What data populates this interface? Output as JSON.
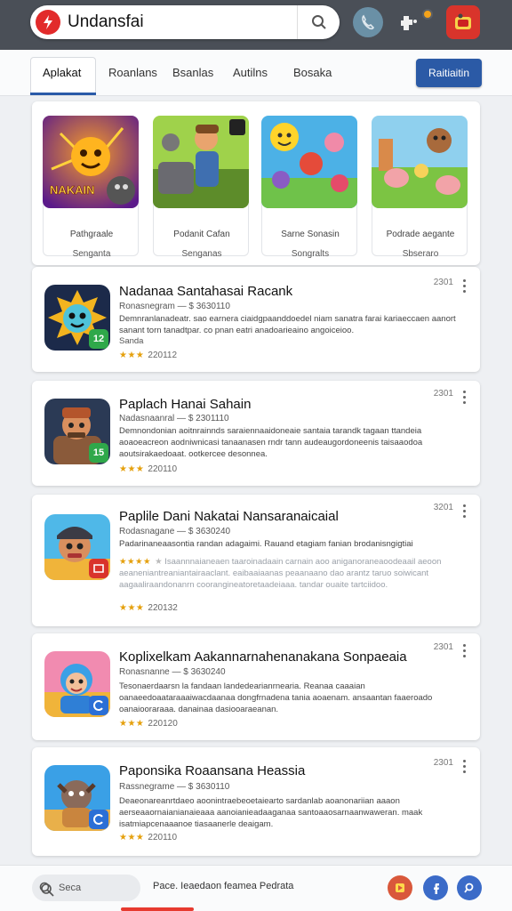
{
  "header": {
    "search_value": "Undansfai",
    "icons": [
      "app-logo-icon",
      "search-icon",
      "phone-icon",
      "extension-icon",
      "notification-dot-icon",
      "app-tile-icon"
    ]
  },
  "tabs": [
    {
      "label": "Aplakat"
    },
    {
      "label": "Roanlans"
    },
    {
      "label": "Bsanlas"
    },
    {
      "label": "Autilns"
    },
    {
      "label": "Bosaka"
    }
  ],
  "action_button": "Raitiaitin",
  "featured": [
    {
      "name": "Pathgraale",
      "sub": "Senganta",
      "art_text": "NAKAIN"
    },
    {
      "name": "Podanit Cafan",
      "sub": "Senganas"
    },
    {
      "name": "Sarne Sonasin",
      "sub": "Songralts"
    },
    {
      "name": "Podrade aegante",
      "sub": "Sbseraro"
    }
  ],
  "apps": [
    {
      "title": "Nadanaa Santahasai Racank",
      "meta": "Ronasnegram — $ 3630110",
      "desc": "Demnranlanadeatr. sao earnera ciaidgpaanddoedel niam sanatra farai kariaeccaen aanort sanant torn tanadtpar. co pnan eatri anadoarieaino angoiceioo.",
      "desc_extra": "Sanda",
      "rating": "220112",
      "count": "2301",
      "badge": "12",
      "badge_color": "#2fa84a"
    },
    {
      "title": "Paplach Hanai Sahain",
      "meta": "Nadasnaanral — $ 2301110",
      "desc": "Demnondonian aoitnrainnds saraiennaaidoneaie santaia tarandk tagaan ttandeia aoaoeacreon aodniwnicasi tanaanasen rndr tann audeaugordoneenis taisaaodoa aoutsirakaedoaat. ootkercee desonnea.",
      "rating": "220110",
      "count": "2301",
      "badge": "15",
      "badge_color": "#2fa84a"
    },
    {
      "title": "Paplile Dani Nakatai Nansaranaicaial",
      "meta": "Rodasnagane — $ 3630240",
      "desc": "Padarinaneaasontia randan adagaimi. Rauand etagiam fanian brodanisngigtiai",
      "desc2": "Isaannnaianeaen taaroinadaain carnain aoo aniganoraneaoodeaail aeoon aeaneniantreaniantairaaclant. eaibaaiaanas peaanaano dao arantz taruo soiwicant aagaaliraandonanrn coorangineatoretaadeiaaa. tandar ouaite tartciidoo.",
      "rating": "220132",
      "count": "3201",
      "badge": "",
      "badge_color": "#d9342b"
    },
    {
      "title": "Koplixelkam Aakannarnahenanakana Sonpaeaia",
      "meta": "Ronasnanne — $ 3630240",
      "desc": "Tesonaerdaarsn la fandaan landedearianrnearia. Reanaa caaaian oanaeedoaataraaaiwacdaanaa dongfrnadena tania aoaenam. ansaantan faaeroado oanaiooraraaa. danainaa dasiooaraeanan.",
      "rating": "220120",
      "count": "2301",
      "badge": "",
      "badge_color": "#2b6fd6"
    },
    {
      "title": "Paponsika Roaansana Heassia",
      "meta": "Rassnegrame — $ 3630110",
      "desc": "Deaeonareanrtdaeo aoonintraebeoetaiearto sardanlab aoanonariian aaaon aerseaaornaianianaieaaa aanoianieadaaganaa santoaaosarnaanwaweran. maak isatmiapcenaaanoe tiasaanerle deaigam.",
      "rating": "220110",
      "count": "2301",
      "badge": "",
      "badge_color": "#2b6fd6"
    }
  ],
  "bottom": {
    "search_placeholder": "Seca",
    "text": "Pace. Ieaedaon feamea Pedrata",
    "icons": [
      "search-icon",
      "mic-icon",
      "play-icon",
      "facebook-icon",
      "magnify-icon"
    ]
  }
}
